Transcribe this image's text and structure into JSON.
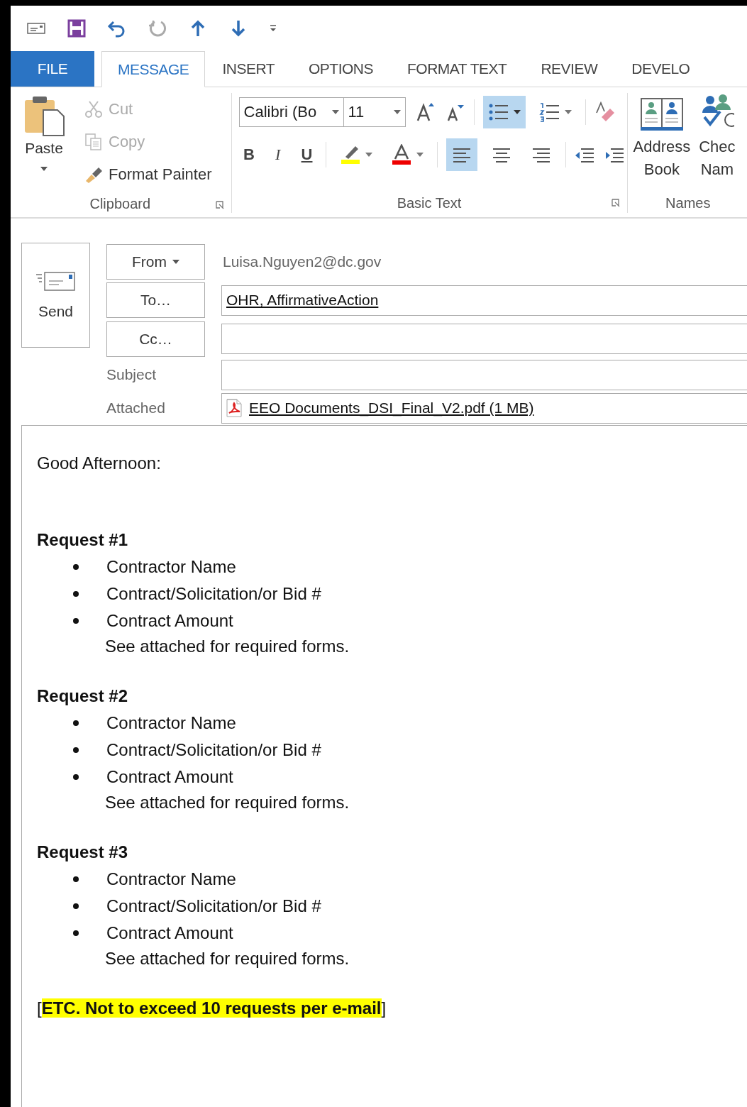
{
  "tabs": [
    {
      "label": "FILE",
      "kind": "file",
      "selected": false
    },
    {
      "label": "MESSAGE",
      "kind": "tab",
      "selected": true
    },
    {
      "label": "INSERT",
      "kind": "tab",
      "selected": false
    },
    {
      "label": "OPTIONS",
      "kind": "tab",
      "selected": false
    },
    {
      "label": "FORMAT TEXT",
      "kind": "tab",
      "selected": false
    },
    {
      "label": "REVIEW",
      "kind": "tab",
      "selected": false
    },
    {
      "label": "DEVELO",
      "kind": "tab",
      "selected": false
    }
  ],
  "ribbon": {
    "clipboard": {
      "label": "Clipboard",
      "paste": "Paste",
      "tools": [
        {
          "kind": "cut",
          "label": "Cut",
          "disabled": true
        },
        {
          "kind": "copy",
          "label": "Copy",
          "disabled": true
        },
        {
          "kind": "painter",
          "label": "Format Painter",
          "disabled": false
        }
      ]
    },
    "basic_text": {
      "label": "Basic Text",
      "font": "Calibri (Bo",
      "size": "11",
      "lists": [
        {
          "kind": "bullets",
          "selected": true
        },
        {
          "kind": "numbering",
          "selected": false
        }
      ],
      "styles": [
        {
          "kind": "bold",
          "label": "B"
        },
        {
          "kind": "italic",
          "label": "I"
        },
        {
          "kind": "underline",
          "label": "U"
        }
      ],
      "alignment": [
        {
          "kind": "left",
          "selected": true
        },
        {
          "kind": "center",
          "selected": false
        },
        {
          "kind": "right",
          "selected": false
        }
      ]
    },
    "names": {
      "label": "Names",
      "buttons": [
        {
          "kind": "address",
          "lines": [
            "Address",
            "Book"
          ]
        },
        {
          "kind": "check",
          "lines": [
            "Chec",
            "Nam"
          ]
        }
      ]
    }
  },
  "message": {
    "send": "Send",
    "from": {
      "button": "From",
      "value": "Luisa.Nguyen2@dc.gov"
    },
    "to": {
      "button": "To…",
      "value": "OHR, AffirmativeAction"
    },
    "cc": {
      "button": "Cc…"
    },
    "subject": {
      "label": "Subject"
    },
    "attached": {
      "label": "Attached",
      "file": "EEO Documents_DSI_Final_V2.pdf (1 MB)"
    }
  },
  "body": {
    "greeting": "Good Afternoon:",
    "requests": [
      {
        "title": "Request #1",
        "items": [
          "Contractor Name",
          "Contract/Solicitation/or Bid #",
          "Contract Amount"
        ],
        "note": "See attached for required forms."
      },
      {
        "title": "Request #2",
        "items": [
          "Contractor Name",
          "Contract/Solicitation/or Bid #",
          "Contract Amount"
        ],
        "note": "See attached for required forms."
      },
      {
        "title": "Request #3",
        "items": [
          "Contractor Name",
          "Contract/Solicitation/or Bid #",
          "Contract Amount"
        ],
        "note": "See attached for required forms."
      }
    ],
    "closing": {
      "open": "[",
      "highlight": "ETC. Not to exceed 10 requests per e-mail",
      "close": "]"
    }
  }
}
